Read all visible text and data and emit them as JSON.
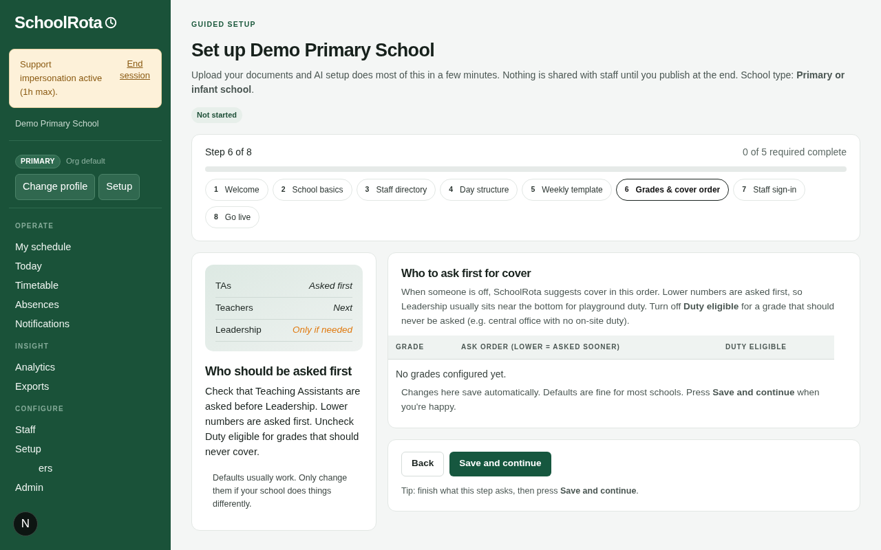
{
  "sidebar": {
    "logo": "SchoolRota",
    "banner": {
      "text": "Support impersonation active (1h max).",
      "link": "End session"
    },
    "school": "Demo Primary School",
    "profile": {
      "badge": "PRIMARY",
      "note": "Org default",
      "buttons": [
        "Change profile",
        "Setup"
      ]
    },
    "sections": [
      {
        "heading": "OPERATE",
        "items": [
          "My schedule",
          "Today",
          "Timetable",
          "Absences",
          "Notifications"
        ]
      },
      {
        "heading": "INSIGHT",
        "items": [
          "Analytics",
          "Exports"
        ]
      },
      {
        "heading": "CONFIGURE",
        "items": [
          "Staff",
          "Setup",
          "ers",
          "Admin"
        ]
      }
    ],
    "avatar": "N"
  },
  "header": {
    "eyebrow": "GUIDED SETUP",
    "title": "Set up Demo Primary School",
    "intro": "Upload your documents and AI setup does most of this in a few minutes. Nothing is shared with staff until you publish at the end. School type: **Primary or infant school**.",
    "status": "Not started"
  },
  "progress": {
    "step": "Step 6 of 8",
    "summary": "0 of 5 required complete",
    "level": 0,
    "steps": [
      {
        "number": "1",
        "label": "Welcome",
        "selected": false
      },
      {
        "number": "2",
        "label": "School basics",
        "selected": false
      },
      {
        "number": "3",
        "label": "Staff directory",
        "selected": false
      },
      {
        "number": "4",
        "label": "Day structure",
        "selected": false
      },
      {
        "number": "5",
        "label": "Weekly template",
        "selected": false
      },
      {
        "number": "6",
        "label": "Grades & cover order",
        "selected": true
      },
      {
        "number": "7",
        "label": "Staff sign-in",
        "selected": false
      },
      {
        "number": "8",
        "label": "Go live",
        "selected": false
      }
    ]
  },
  "guide": {
    "legend": [
      {
        "label": "TAs",
        "value": "Asked first",
        "kind": "normal"
      },
      {
        "label": "Teachers",
        "value": "Next",
        "kind": "normal"
      },
      {
        "label": "Leadership",
        "value": "Only if needed",
        "kind": "warning"
      }
    ],
    "title": "Who should be asked first",
    "body": "Check that Teaching Assistants are asked before Leadership. Lower numbers are asked first. Uncheck Duty eligible for grades that should never cover.",
    "note": "Defaults usually work. Only change them if your school does things differently."
  },
  "cover": {
    "title": "Who to ask first for cover",
    "description": "When someone is off, SchoolRota suggests cover in this order. Lower numbers are asked first, so Leadership usually sits near the bottom for playground duty. Turn off **Duty eligible** for a grade that should never be asked (e.g. central office with no on-site duty).",
    "table": {
      "columns": [
        "GRADE",
        "ASK ORDER (LOWER = ASKED SOONER)",
        "DUTY ELIGIBLE"
      ],
      "empty": "No grades configured yet."
    },
    "footnote": "Changes here save automatically. Defaults are fine for most schools. Press **Save and continue** when you're happy."
  },
  "actions": {
    "back": "Back",
    "primary": "Save and continue",
    "tip": "Tip: finish what this step asks, then press **Save and continue**."
  }
}
